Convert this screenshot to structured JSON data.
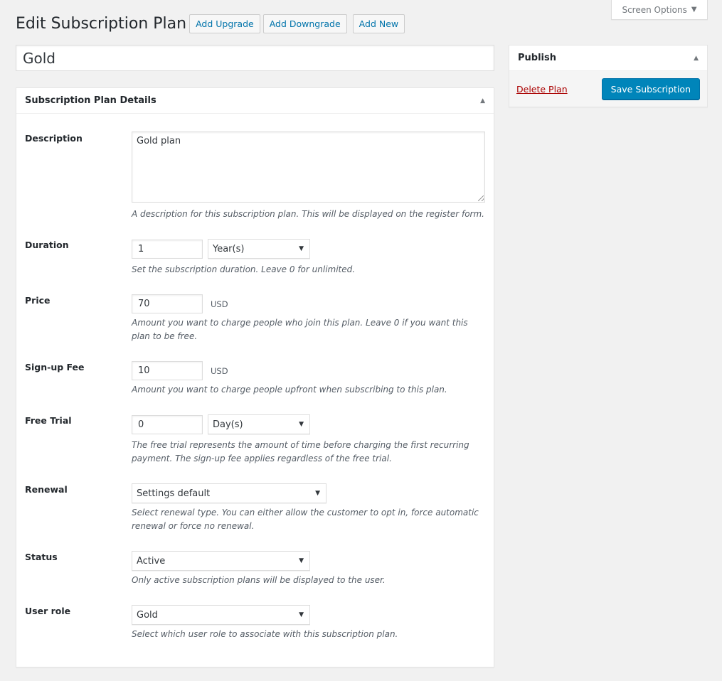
{
  "screen_options": {
    "label": "Screen Options",
    "arrow": "▼"
  },
  "header": {
    "title": "Edit Subscription Plan",
    "buttons": [
      "Add Upgrade",
      "Add Downgrade",
      "Add New"
    ]
  },
  "plan_title": "Gold",
  "details": {
    "title": "Subscription Plan Details",
    "toggle": "▲",
    "description": {
      "label": "Description",
      "value": "Gold plan",
      "help": "A description for this subscription plan. This will be displayed on the register form."
    },
    "duration": {
      "label": "Duration",
      "value": "1",
      "unit": "Year(s)",
      "help": "Set the subscription duration. Leave 0 for unlimited."
    },
    "price": {
      "label": "Price",
      "value": "70",
      "currency": "USD",
      "help": "Amount you want to charge people who join this plan. Leave 0 if you want this plan to be free."
    },
    "signup_fee": {
      "label": "Sign-up Fee",
      "value": "10",
      "currency": "USD",
      "help": "Amount you want to charge people upfront when subscribing to this plan."
    },
    "free_trial": {
      "label": "Free Trial",
      "value": "0",
      "unit": "Day(s)",
      "help": "The free trial represents the amount of time before charging the first recurring payment. The sign-up fee applies regardless of the free trial."
    },
    "renewal": {
      "label": "Renewal",
      "value": "Settings default",
      "help": "Select renewal type. You can either allow the customer to opt in, force automatic renewal or force no renewal."
    },
    "status": {
      "label": "Status",
      "value": "Active",
      "help": "Only active subscription plans will be displayed to the user."
    },
    "user_role": {
      "label": "User role",
      "value": "Gold",
      "help": "Select which user role to associate with this subscription plan."
    }
  },
  "publish": {
    "title": "Publish",
    "toggle": "▲",
    "delete_label": "Delete Plan",
    "save_label": "Save Subscription"
  },
  "icons": {
    "caret": "▼"
  },
  "colors": {
    "primary": "#0085ba",
    "link": "#0073aa",
    "delete": "#a00000",
    "background": "#f1f1f1"
  }
}
